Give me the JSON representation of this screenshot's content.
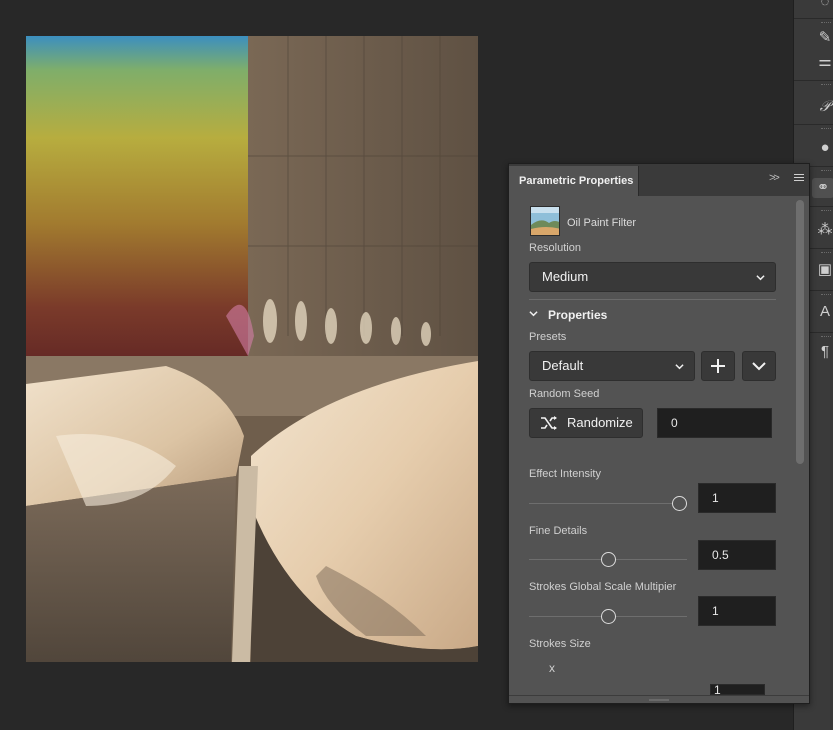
{
  "panel": {
    "title": "Parametric Properties",
    "collapse_glyph": ">>",
    "filter_name": "Oil Paint Filter",
    "resolution": {
      "label": "Resolution",
      "value": "Medium"
    },
    "properties_section": "Properties",
    "presets": {
      "label": "Presets",
      "value": "Default"
    },
    "random_seed": {
      "label": "Random Seed",
      "button_label": "Randomize",
      "value": "0"
    },
    "effect_intensity": {
      "label": "Effect Intensity",
      "value": "1",
      "level": 0.95
    },
    "fine_details": {
      "label": "Fine Details",
      "value": "0.5",
      "level": 0.5
    },
    "strokes_scale": {
      "label": "Strokes Global Scale Multipier",
      "value": "1",
      "level": 0.5
    },
    "strokes_size": {
      "label": "Strokes Size",
      "axis_label": "x",
      "value": "1"
    }
  },
  "icons": {
    "toolbar": [
      "brush-settings-icon",
      "adjust-icon",
      "paragraph-style-icon",
      "color-icon",
      "parametric-filter-icon",
      "channels-icon",
      "gradient-icon",
      "character-icon",
      "paragraph-icon"
    ]
  },
  "colors": {
    "panel_bg": "#535353",
    "header_bg": "#3a3a3a",
    "app_bg": "#282828",
    "field_bg": "#1f1f1f"
  }
}
